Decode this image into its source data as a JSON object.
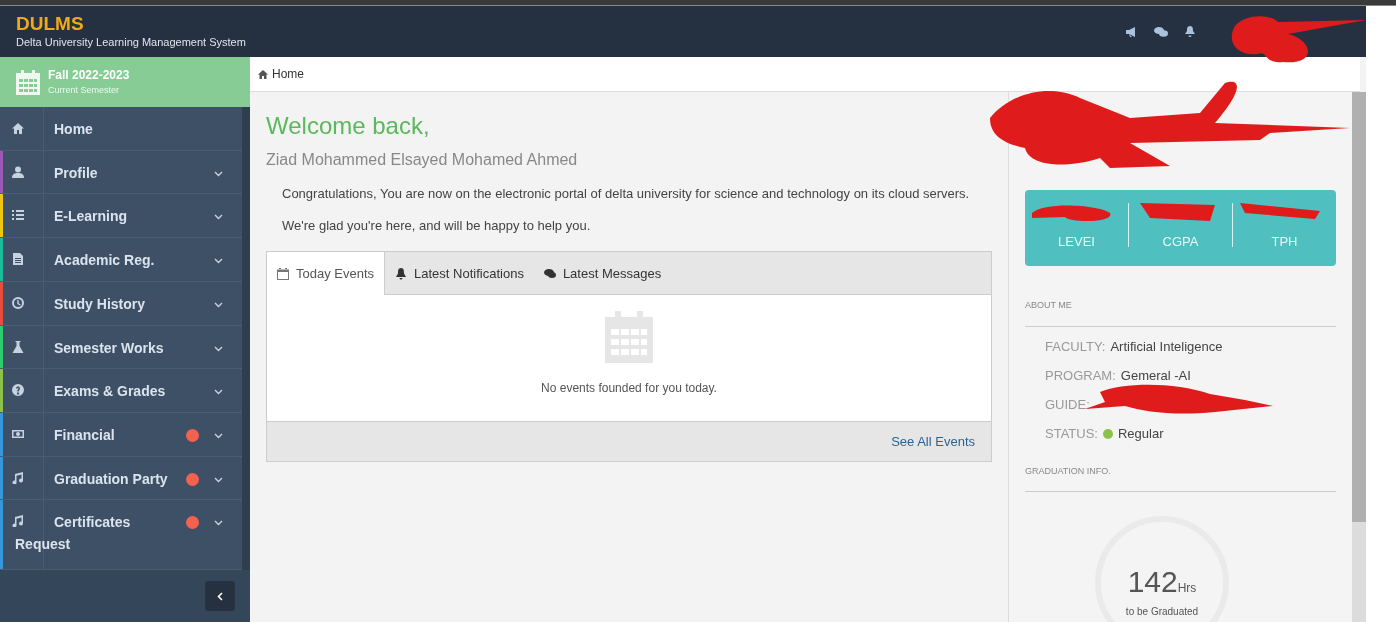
{
  "header": {
    "logo": "DULMS",
    "subtitle": "Delta University Learning Management System"
  },
  "semester": {
    "title": "Fall 2022-2023",
    "caption": "Current Semester"
  },
  "sidebar": {
    "items": [
      {
        "label": "Home",
        "badge": false,
        "expandable": false
      },
      {
        "label": "Profile",
        "color": "#9b59b6",
        "badge": false,
        "expandable": true
      },
      {
        "label": "E-Learning",
        "color": "#f1c40f",
        "badge": false,
        "expandable": true
      },
      {
        "label": "Academic Reg.",
        "color": "#1abc9c",
        "badge": false,
        "expandable": true
      },
      {
        "label": "Study History",
        "color": "#e74c3c",
        "badge": false,
        "expandable": true
      },
      {
        "label": "Semester Works",
        "color": "#2ecc71",
        "badge": false,
        "expandable": true
      },
      {
        "label": "Exams & Grades",
        "color": "#8bc34a",
        "badge": false,
        "expandable": true
      },
      {
        "label": "Financial",
        "color": "#3498db",
        "badge": true,
        "expandable": true
      },
      {
        "label": "Graduation Party",
        "color": "#3498db",
        "badge": true,
        "expandable": true
      },
      {
        "label": "Certificates Request",
        "color": "#3498db",
        "badge": true,
        "expandable": true
      }
    ]
  },
  "breadcrumb": "Home",
  "welcome": {
    "title": "Welcome back,",
    "name": "Ziad Mohammed Elsayed Mohamed Ahmed",
    "lines": [
      "Congratulations, You are now on the electronic portal of delta university for science and technology on its cloud servers.",
      "We're glad you're here, and will be happy to help you."
    ]
  },
  "tabs": [
    {
      "label": "Today Events",
      "selected": true
    },
    {
      "label": "Latest Notifications",
      "selected": false
    },
    {
      "label": "Latest Messages",
      "selected": false
    }
  ],
  "events": {
    "empty_text": "No events founded for you today.",
    "link": "See All Events"
  },
  "stats": [
    "LEVEI",
    "CGPA",
    "TPH"
  ],
  "about": {
    "heading": "ABOUT ME",
    "fields": [
      {
        "label": "FACULTY:",
        "value": "Artificial Inteligence"
      },
      {
        "label": "PROGRAM:",
        "value": "Gemeral -AI"
      },
      {
        "label": "GUIDE:"
      },
      {
        "label": "STATUS:",
        "value": "Regular",
        "color": "#8bc34a"
      }
    ]
  },
  "graduation": {
    "heading": "GRADUATION INFO.",
    "hours": "142",
    "unit": "Hrs",
    "caption": "to be Graduated"
  }
}
